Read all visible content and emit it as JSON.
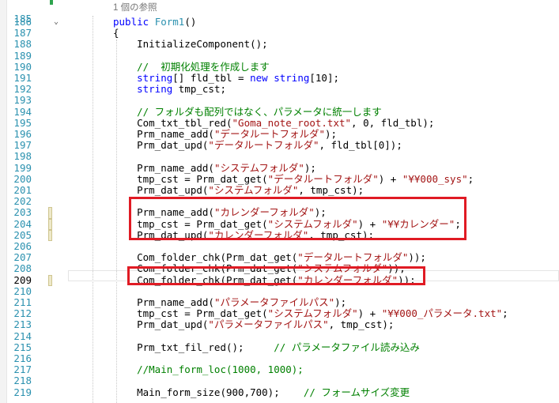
{
  "editor": {
    "ref_hint": "1 個の参照",
    "lines": [
      {
        "num": "186",
        "tokens": [
          {
            "t": "public ",
            "c": "kw"
          },
          {
            "t": "Form1",
            "c": "ty"
          },
          {
            "t": "()",
            "c": "def"
          }
        ]
      },
      {
        "num": "187",
        "tokens": [
          {
            "t": "{",
            "c": "def"
          }
        ]
      },
      {
        "num": "188",
        "tokens": [
          {
            "t": "    InitializeComponent();",
            "c": "def"
          }
        ]
      },
      {
        "num": "189",
        "tokens": []
      },
      {
        "num": "190",
        "tokens": [
          {
            "t": "    //  初期化処理を作成します",
            "c": "com"
          }
        ]
      },
      {
        "num": "191",
        "tokens": [
          {
            "t": "    ",
            "c": "def"
          },
          {
            "t": "string",
            "c": "kw"
          },
          {
            "t": "[] fld_tbl = ",
            "c": "def"
          },
          {
            "t": "new ",
            "c": "kw"
          },
          {
            "t": "string",
            "c": "kw"
          },
          {
            "t": "[10];",
            "c": "def"
          }
        ]
      },
      {
        "num": "192",
        "tokens": [
          {
            "t": "    ",
            "c": "def"
          },
          {
            "t": "string",
            "c": "kw"
          },
          {
            "t": " tmp_cst;",
            "c": "def"
          }
        ]
      },
      {
        "num": "193",
        "tokens": []
      },
      {
        "num": "194",
        "tokens": [
          {
            "t": "    // フォルダも配列ではなく、パラメータに統一します",
            "c": "com"
          }
        ]
      },
      {
        "num": "195",
        "tokens": [
          {
            "t": "    Com_txt_tbl_red(",
            "c": "def"
          },
          {
            "t": "\"Goma_note_root.txt\"",
            "c": "str"
          },
          {
            "t": ", 0, fld_tbl);",
            "c": "def"
          }
        ]
      },
      {
        "num": "196",
        "tokens": [
          {
            "t": "    Prm_name_add(",
            "c": "def"
          },
          {
            "t": "\"データルートフォルダ\"",
            "c": "str"
          },
          {
            "t": ");",
            "c": "def"
          }
        ]
      },
      {
        "num": "197",
        "tokens": [
          {
            "t": "    Prm_dat_upd(",
            "c": "def"
          },
          {
            "t": "\"データルートフォルダ\"",
            "c": "str"
          },
          {
            "t": ", fld_tbl[0]);",
            "c": "def"
          }
        ]
      },
      {
        "num": "198",
        "tokens": []
      },
      {
        "num": "199",
        "tokens": [
          {
            "t": "    Prm_name_add(",
            "c": "def"
          },
          {
            "t": "\"システムフォルダ\"",
            "c": "str"
          },
          {
            "t": ");",
            "c": "def"
          }
        ]
      },
      {
        "num": "200",
        "tokens": [
          {
            "t": "    tmp_cst = Prm_dat_get(",
            "c": "def"
          },
          {
            "t": "\"データルートフォルダ\"",
            "c": "str"
          },
          {
            "t": ") + ",
            "c": "def"
          },
          {
            "t": "\"¥¥000_sys\"",
            "c": "str"
          },
          {
            "t": ";",
            "c": "def"
          }
        ]
      },
      {
        "num": "201",
        "tokens": [
          {
            "t": "    Prm_dat_upd(",
            "c": "def"
          },
          {
            "t": "\"システムフォルダ\"",
            "c": "str"
          },
          {
            "t": ", tmp_cst);",
            "c": "def"
          }
        ]
      },
      {
        "num": "202",
        "tokens": []
      },
      {
        "num": "203",
        "tokens": [
          {
            "t": "    Prm_name_add(",
            "c": "def"
          },
          {
            "t": "\"カレンダーフォルダ\"",
            "c": "str"
          },
          {
            "t": ");",
            "c": "def"
          }
        ]
      },
      {
        "num": "204",
        "tokens": [
          {
            "t": "    tmp_cst = Prm_dat_get(",
            "c": "def"
          },
          {
            "t": "\"システムフォルダ\"",
            "c": "str"
          },
          {
            "t": ") + ",
            "c": "def"
          },
          {
            "t": "\"¥¥カレンダー\"",
            "c": "str"
          },
          {
            "t": ";",
            "c": "def"
          }
        ]
      },
      {
        "num": "205",
        "tokens": [
          {
            "t": "    Prm_dat_upd(",
            "c": "def"
          },
          {
            "t": "\"カレンダーフォルダ\"",
            "c": "str"
          },
          {
            "t": ", tmp_cst);",
            "c": "def"
          }
        ]
      },
      {
        "num": "206",
        "tokens": []
      },
      {
        "num": "207",
        "tokens": [
          {
            "t": "    Com_folder_chk(Prm_dat_get(",
            "c": "def"
          },
          {
            "t": "\"データルートフォルダ\"",
            "c": "str"
          },
          {
            "t": "));",
            "c": "def"
          }
        ]
      },
      {
        "num": "208",
        "tokens": [
          {
            "t": "    Com_folder_chk(Prm_dat_get(",
            "c": "def"
          },
          {
            "t": "\"システムフォルダ\"",
            "c": "str"
          },
          {
            "t": "));",
            "c": "def"
          }
        ]
      },
      {
        "num": "209",
        "tokens": [
          {
            "t": "    Com_folder_chk(Prm_dat_get(",
            "c": "def"
          },
          {
            "t": "\"カレンダーフォルダ\"",
            "c": "str"
          },
          {
            "t": "));",
            "c": "def"
          }
        ]
      },
      {
        "num": "210",
        "tokens": []
      },
      {
        "num": "211",
        "tokens": [
          {
            "t": "    Prm_name_add(",
            "c": "def"
          },
          {
            "t": "\"パラメータファイルパス\"",
            "c": "str"
          },
          {
            "t": ");",
            "c": "def"
          }
        ]
      },
      {
        "num": "212",
        "tokens": [
          {
            "t": "    tmp_cst = Prm_dat_get(",
            "c": "def"
          },
          {
            "t": "\"システムフォルダ\"",
            "c": "str"
          },
          {
            "t": ") + ",
            "c": "def"
          },
          {
            "t": "\"¥¥000_パラメータ.txt\"",
            "c": "str"
          },
          {
            "t": ";",
            "c": "def"
          }
        ]
      },
      {
        "num": "213",
        "tokens": [
          {
            "t": "    Prm_dat_upd(",
            "c": "def"
          },
          {
            "t": "\"パラメータファイルパス\"",
            "c": "str"
          },
          {
            "t": ", tmp_cst);",
            "c": "def"
          }
        ]
      },
      {
        "num": "214",
        "tokens": []
      },
      {
        "num": "215",
        "tokens": [
          {
            "t": "    Prm_txt_fil_red();     ",
            "c": "def"
          },
          {
            "t": "// パラメータファイル読み込み",
            "c": "com"
          }
        ]
      },
      {
        "num": "216",
        "tokens": []
      },
      {
        "num": "217",
        "tokens": [
          {
            "t": "    //Main_form_loc(1000, 1000);",
            "c": "com"
          }
        ]
      },
      {
        "num": "218",
        "tokens": []
      },
      {
        "num": "219",
        "tokens": [
          {
            "t": "    Main_form_size(900,700);    ",
            "c": "def"
          },
          {
            "t": "// フォームサイズ変更",
            "c": "com"
          }
        ]
      }
    ]
  }
}
